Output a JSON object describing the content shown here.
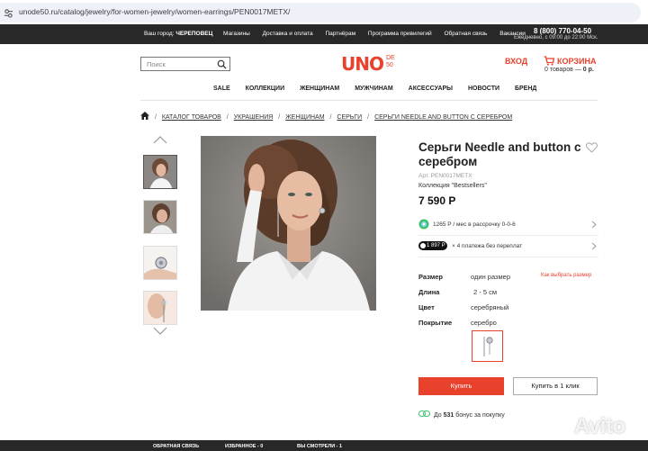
{
  "browser": {
    "url": "unode50.ru/catalog/jewelry/for-women-jewelry/women-earrings/PEN0017METX/"
  },
  "topbar": {
    "city_label": "Ваш город:",
    "city": "ЧЕРЕПОВЕЦ",
    "links": [
      "Магазины",
      "Доставка и оплата",
      "Партнёрам",
      "Программа привилегий",
      "Обратная связь",
      "Вакансии"
    ],
    "phone": "8 (800) 770-04-50",
    "hours": "Ежедневно, с 09:00 до 22:00 Мск."
  },
  "header": {
    "search_placeholder": "Поиск",
    "logo_text": "UNO",
    "logo_sub_1": "DE",
    "logo_sub_2": "50",
    "login": "ВХОД",
    "cart_label": "КОРЗИНА",
    "cart_items": "0 товаров —",
    "cart_total": "0 р."
  },
  "nav": [
    "SALE",
    "КОЛЛЕКЦИИ",
    "ЖЕНЩИНАМ",
    "МУЖЧИНАМ",
    "АКСЕССУАРЫ",
    "НОВОСТИ",
    "БРЕНД"
  ],
  "breadcrumbs": [
    "КАТАЛОГ ТОВАРОВ",
    "УКРАШЕНИЯ",
    "ЖЕНЩИНАМ",
    "СЕРЬГИ",
    "СЕРЬГИ NEEDLE AND BUTTON С СЕРЕБРОМ"
  ],
  "product": {
    "title": "Серьги Needle and button с серебром",
    "article": "Арт. PEN0017METX",
    "collection": "Коллекция \"Bestsellers\"",
    "price": "7 590 Р",
    "installment": "1265 Р / мес в рассрочку 0-0-6",
    "split_badge": "1 897 Р",
    "split_text": "× 4 платежа без переплат",
    "attrs": [
      {
        "key": "Размер",
        "value": "один размер"
      },
      {
        "key": "Длина",
        "value": "2 - 5 см"
      },
      {
        "key": "Цвет",
        "value": "серебряный"
      },
      {
        "key": "Покрытие",
        "value": "серебро"
      }
    ],
    "size_guide": "Как выбрать размер",
    "buy_label": "Купить",
    "one_click_label": "Купить в 1 клик",
    "bonus_prefix": "До",
    "bonus_value": "531",
    "bonus_suffix": "бонус за покупку"
  },
  "bottombar": {
    "feedback": "ОБРАТНАЯ СВЯЗЬ",
    "favorites": "ИЗБРАННОЕ - 0",
    "viewed": "ВЫ СМОТРЕЛИ - 1"
  },
  "watermark": "Avito",
  "colors": {
    "accent": "#e8412c",
    "dark_bar": "#282828"
  }
}
